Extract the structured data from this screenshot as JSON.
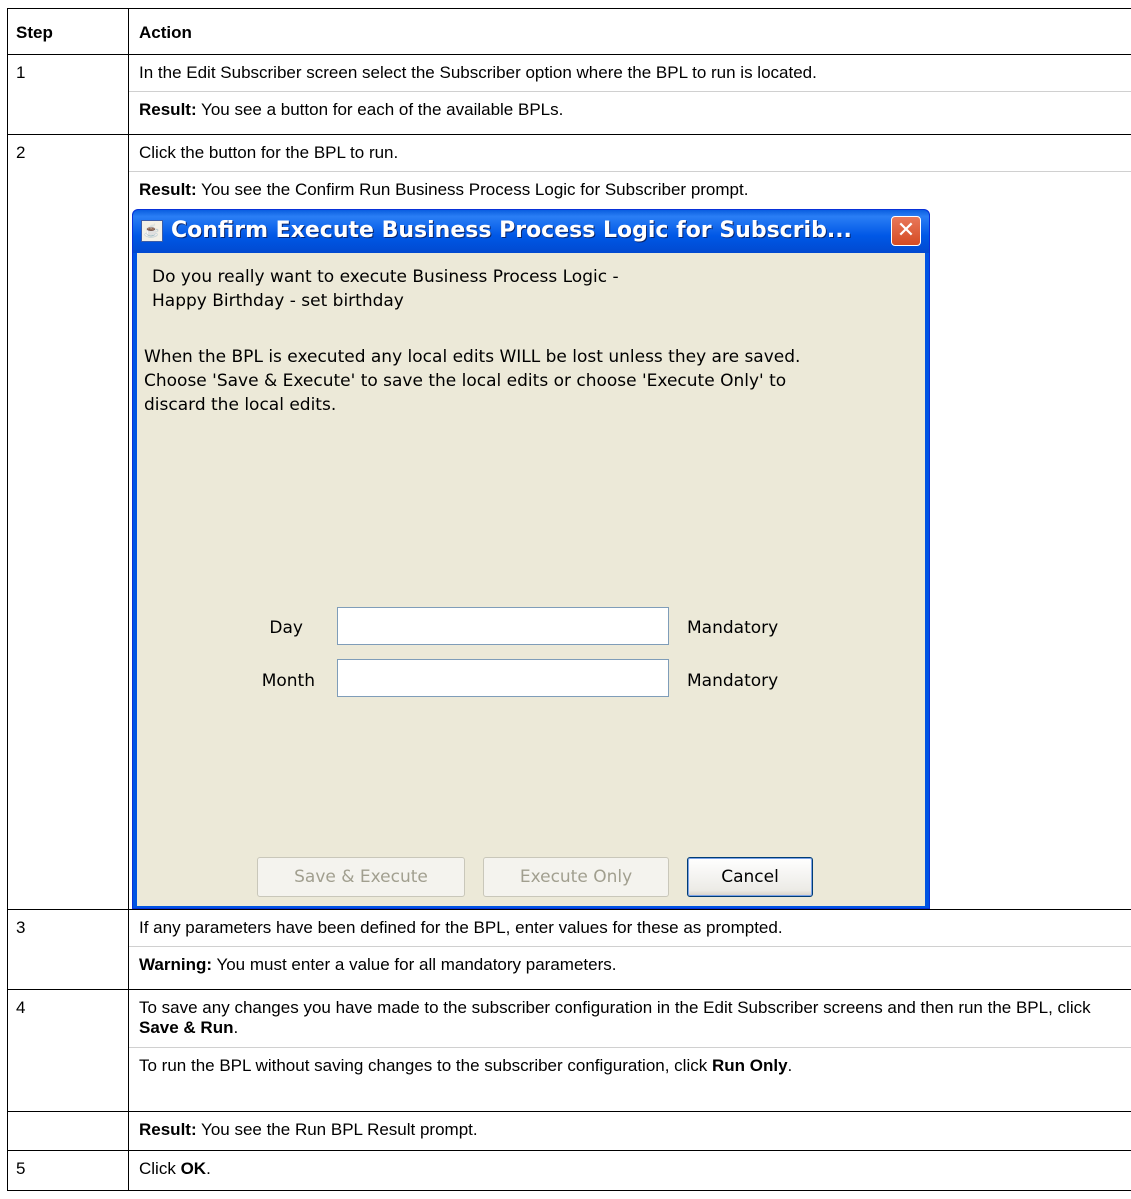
{
  "table": {
    "headers": {
      "step": "Step",
      "action": "Action"
    },
    "rows": {
      "r1": {
        "step": "1",
        "line1": "In the Edit Subscriber screen select the Subscriber option where the BPL to run is located.",
        "result_label": "Result:",
        "result_text": " You see a button for each of the available BPLs."
      },
      "r2": {
        "step": "2",
        "line1": "Click the button for the BPL to run.",
        "result_label": "Result:",
        "result_text": " You see the Confirm Run Business Process Logic for Subscriber prompt."
      },
      "r3": {
        "step": "3",
        "line1": "If any parameters have been defined for the BPL, enter values for these as prompted.",
        "warning_label": "Warning:",
        "warning_text": " You must enter a value for all mandatory parameters."
      },
      "r4": {
        "step": "4",
        "line1_pre": "To save any changes you have made to the subscriber configuration in the Edit Subscriber screens and then run the BPL, click ",
        "line1_bold": "Save & Run",
        "line1_post": ".",
        "line2_pre": "To run the BPL without saving changes to the subscriber configuration, click ",
        "line2_bold": "Run Only",
        "line2_post": "."
      },
      "r5": {
        "step": "",
        "result_label": "Result:",
        "result_text": " You see the Run BPL Result prompt."
      },
      "r6": {
        "step": "5",
        "pre": "Click ",
        "bold": "OK",
        "post": "."
      }
    }
  },
  "dialog": {
    "title": "Confirm Execute Business Process Logic for Subscrib...",
    "close_symbol": "✕",
    "question_line1": "Do you really want to execute Business Process Logic -",
    "question_line2": "Happy Birthday - set birthday",
    "warning_line1": "When the BPL is executed any local edits WILL be lost unless they are saved.",
    "warning_line2": "Choose 'Save & Execute' to save the local edits or choose 'Execute Only' to",
    "warning_line3": "discard the local edits.",
    "fields": {
      "day": {
        "label": "Day",
        "value": "",
        "note": "Mandatory"
      },
      "month": {
        "label": "Month",
        "value": "",
        "note": "Mandatory"
      }
    },
    "buttons": {
      "save_execute": "Save & Execute",
      "execute_only": "Execute Only",
      "cancel": "Cancel"
    },
    "title_icon": "java-cup-icon",
    "colors": {
      "titlebar": "#0058e6",
      "body": "#ece9d8",
      "close": "#d54b23"
    }
  }
}
